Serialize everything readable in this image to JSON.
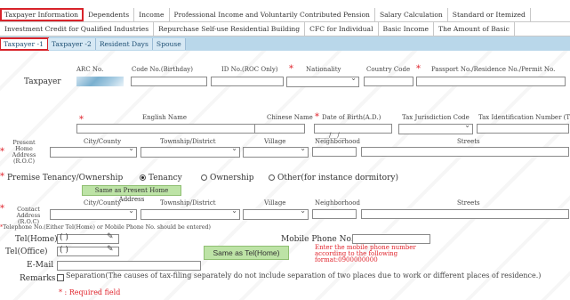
{
  "top_tabs_1": [
    "Taxpayer Information",
    "Dependents",
    "Income",
    "Professional Income and Voluntarily Contributed Pension",
    "Salary Calculation",
    "Standard or Itemized"
  ],
  "top_tabs_2": [
    "Investment Credit for Qualified Industries",
    "Repurchase Self-use Residential Building",
    "CFC for Individual",
    "Basic Income",
    "The Amount of Basic"
  ],
  "sub_tabs": [
    "Taxpayer -1",
    "Taxpayer -2",
    "Resident Days",
    "Spouse"
  ],
  "taxpayer": {
    "label": "Taxpayer",
    "arc_no": "ARC No.",
    "code_no": "Code No.(Birthday)",
    "id_no": "ID No.(ROC Only)",
    "nationality": "Nationality",
    "country_code": "Country Code",
    "passport": "Passport No./Residence No./Permit No.",
    "english_name": "English Name",
    "chinese_name": "Chinese Name",
    "dob": "Date of Birth(A.D.)",
    "dob_value": "____/__/__",
    "tax_code": "Tax Jurisdiction Code",
    "tin": "Tax Identification Number (TIN)"
  },
  "home_address": {
    "label": "Present Home Address (R.O.C)",
    "city": "City/County",
    "township": "Township/District",
    "village": "Village",
    "neighborhood": "Neighborhood",
    "streets": "Streets"
  },
  "premise": {
    "label": "Premise Tenancy/Ownership",
    "options": [
      "Tenancy",
      "Ownership",
      "Other(for instance dormitory)"
    ],
    "selected": "Tenancy",
    "same_button": "Same as Present Home Address"
  },
  "contact_address": {
    "label": "Contact Address (R.O.C)",
    "city": "City/County",
    "township": "Township/District",
    "village": "Village",
    "neighborhood": "Neighborhood",
    "streets": "Streets"
  },
  "phone_note": "Telephone No.(Either Tel(Home) or Mobile Phone No. should be entered)",
  "tel_home": {
    "label": "Tel(Home)",
    "value": "(    )"
  },
  "tel_office": {
    "label": "Tel(Office)",
    "value": "(    )"
  },
  "same_tel_button": "Same as Tel(Home)",
  "mobile": {
    "label": "Mobile Phone No.",
    "hint": "Enter the mobile phone number according to the following format:0900000000"
  },
  "email": {
    "label": "E-Mail"
  },
  "remarks": {
    "label": "Remarks",
    "text": "Separation(The causes of tax-filing separately do not include separation of two places due to work or different places of residence.)"
  },
  "required_note": "* : Required field",
  "colors": {
    "required": "#e0242c",
    "subtab_bg": "#b9d7ea",
    "button_green": "#bde3a6",
    "highlight": "#d8232a"
  }
}
